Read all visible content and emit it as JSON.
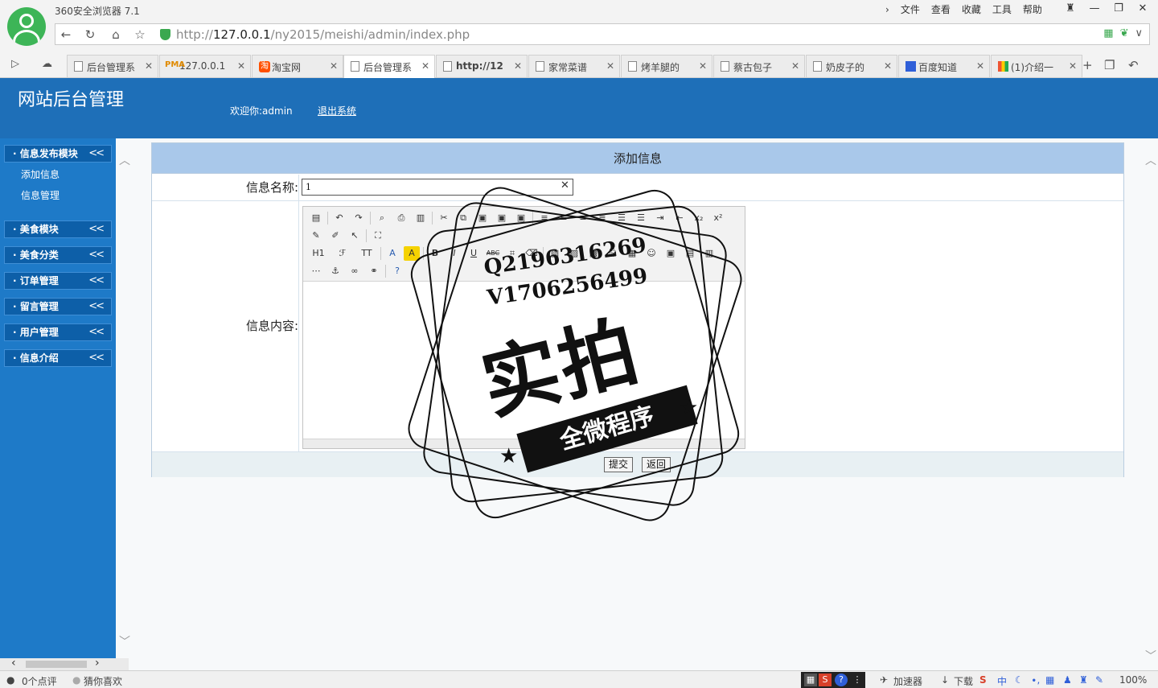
{
  "browser": {
    "title": "360安全浏览器 7.1",
    "menu": [
      "文件",
      "查看",
      "收藏",
      "工具",
      "帮助"
    ],
    "url_scheme": "http://",
    "url_host": "127.0.0.1",
    "url_path": "/ny2015/meishi/admin/index.php",
    "tabs": [
      {
        "label": "后台管理系"
      },
      {
        "label": "127.0.0.1"
      },
      {
        "label": "淘宝网"
      },
      {
        "label": "后台管理系"
      },
      {
        "label": "http://12"
      },
      {
        "label": "家常菜谱"
      },
      {
        "label": "烤羊腿的"
      },
      {
        "label": "蔡古包子"
      },
      {
        "label": "奶皮子的"
      },
      {
        "label": "百度知道"
      },
      {
        "label": "(1)介绍一"
      }
    ],
    "tab_icon_text": {
      "pma": "PMA",
      "tao": "淘"
    }
  },
  "header": {
    "site_title": "网站后台管理",
    "welcome": "欢迎你:admin",
    "logout": "退出系统"
  },
  "sidebar": {
    "modules": [
      {
        "label": "· 信息发布模块"
      },
      {
        "label": "· 美食模块"
      },
      {
        "label": "· 美食分类"
      },
      {
        "label": "· 订单管理"
      },
      {
        "label": "· 留言管理"
      },
      {
        "label": "· 用户管理"
      },
      {
        "label": "· 信息介绍"
      }
    ],
    "sub_items": [
      {
        "label": "添加信息"
      },
      {
        "label": "信息管理"
      }
    ],
    "chevron": "<<"
  },
  "form": {
    "heading": "添加信息",
    "name_label": "信息名称:",
    "name_value": "1",
    "content_label": "信息内容:",
    "submit_label": "提交",
    "back_label": "返回"
  },
  "editor_toolbar": {
    "row3": [
      "H1",
      "ℱ",
      "TT",
      "A",
      "A",
      "B",
      "I",
      "U",
      "ABC"
    ]
  },
  "watermark": {
    "line1": "Q2196316269",
    "line2": "V1706256499",
    "big": "实拍",
    "ribbon": "全微程序"
  },
  "statusbar": {
    "comments": "0个点评",
    "guess": "猜你喜欢",
    "accelerator": "加速器",
    "download": "下载",
    "zoom": "100%",
    "ime": "中",
    "tray_s": "S"
  },
  "colors": {
    "header_blue": "#1e6fb8",
    "sidebar_blue": "#1e7ac8",
    "form_head": "#a9c8ea"
  }
}
